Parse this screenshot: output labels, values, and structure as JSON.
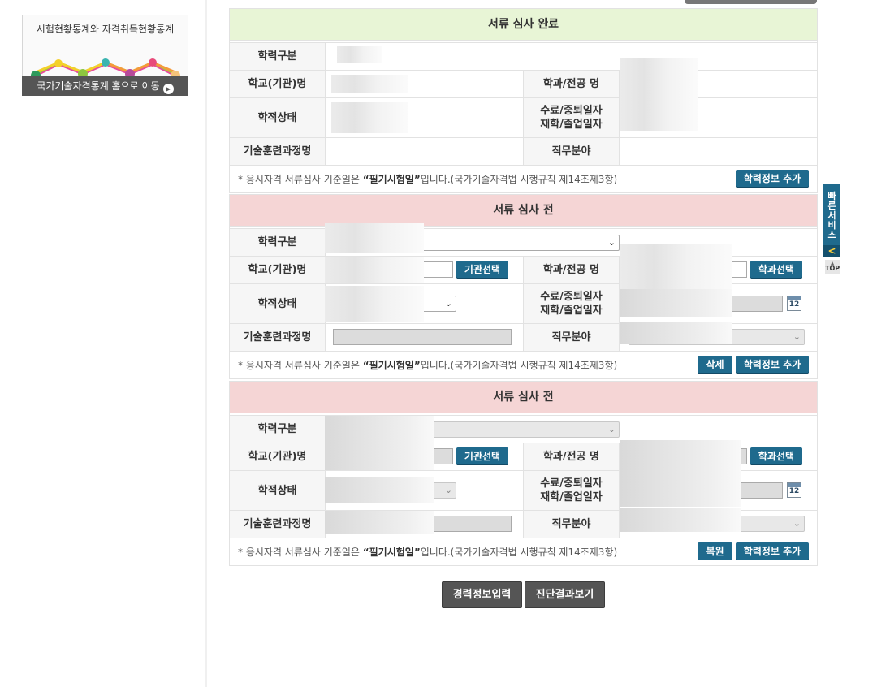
{
  "promo": {
    "title": "시험현황통계와 자격취득현황통계",
    "link_label": "국가기술자격통계 홈으로 이동",
    "arrow_icon": "play-circle-icon"
  },
  "labels": {
    "edu_category": "학력구분",
    "school_name": "학교(기관)명",
    "major": "학과/전공 명",
    "status": "학적상태",
    "dates_line1": "수료/중퇴일자",
    "dates_line2": "재학/졸업일자",
    "training_course": "기술훈련과정명",
    "job_field": "직무분야"
  },
  "note": {
    "prefix": "* 응시자격 서류심사 기준일은 ",
    "emph": "“필기시험일”",
    "suffix": "입니다.(국가기술자격법 시행규칙 제14조제3항)"
  },
  "sections": [
    {
      "title": "서류 심사 완료",
      "add_label": "학력정보 추가"
    },
    {
      "title": "서류 심사 전",
      "org_select_label": "기관선택",
      "major_select_label": "학과선택",
      "delete_label": "삭제",
      "add_label": "학력정보 추가",
      "calendar_text": "12"
    },
    {
      "title": "서류 심사 전",
      "org_select_label": "기관선택",
      "major_select_label": "학과선택",
      "restore_label": "복원",
      "add_label": "학력정보 추가",
      "calendar_text": "12"
    }
  ],
  "actions": {
    "career_input": "경력정보입력",
    "diagnosis": "진단결과보기"
  },
  "quick_service": {
    "label": "빠른서비스",
    "arrow": "<",
    "top_label": "TOP"
  },
  "colors": {
    "done_header": "#e8f5d6",
    "pending_header": "#f5d5d5",
    "button_blue": "#1f6a8d",
    "button_dark": "#555555"
  }
}
